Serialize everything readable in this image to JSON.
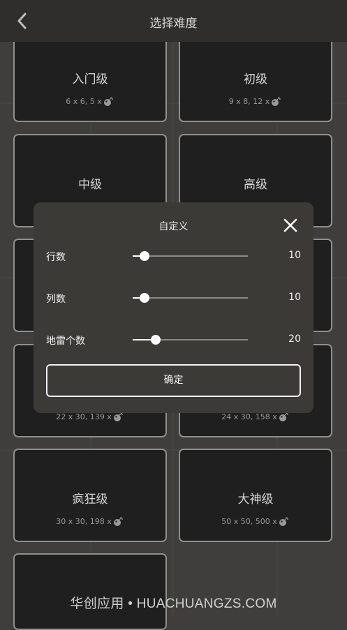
{
  "header": {
    "title": "选择难度"
  },
  "levels": [
    {
      "name": "入门级",
      "spec": "6 x 6,  5 x"
    },
    {
      "name": "初级",
      "spec": "9 x 8,  12 x"
    },
    {
      "name": "中级",
      "spec": ""
    },
    {
      "name": "高级",
      "spec": ""
    },
    {
      "name": "",
      "spec": ""
    },
    {
      "name": "",
      "spec": ""
    },
    {
      "name": "",
      "spec": "22 x 30,  139 x"
    },
    {
      "name": "",
      "spec": "24 x 30,  158 x"
    },
    {
      "name": "疯狂级",
      "spec": "30 x 30,  198 x"
    },
    {
      "name": "大神级",
      "spec": "50 x 50,  500 x"
    },
    {
      "name": "",
      "spec": ""
    }
  ],
  "icons": {
    "back": "chevron-left-icon",
    "close": "close-icon",
    "mine": "bomb-icon"
  },
  "dialog": {
    "title": "自定义",
    "rows": [
      {
        "label": "行数",
        "value": "10",
        "fraction": 0.1
      },
      {
        "label": "列数",
        "value": "10",
        "fraction": 0.1
      },
      {
        "label": "地雷个数",
        "value": "20",
        "fraction": 0.2
      }
    ],
    "confirm_label": "确定"
  },
  "watermark": "华创应用 • HUACHUANGZS.COM",
  "colors": {
    "background": "#3f3e3c",
    "card": "#1f1f1f",
    "dialog": "#3b3a37",
    "accent": "#ffffff"
  }
}
